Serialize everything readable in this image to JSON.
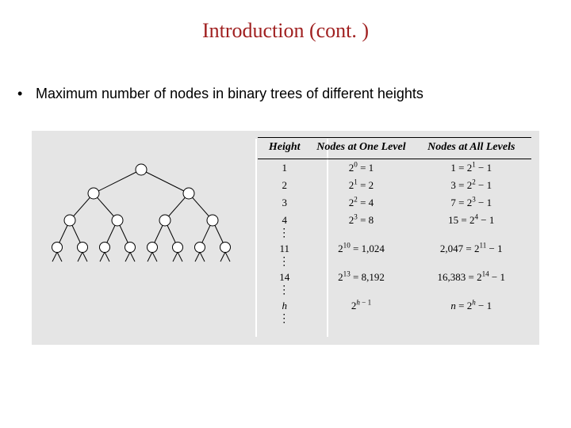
{
  "title": "Introduction (cont. )",
  "bullet": "Maximum number of nodes in binary trees of different heights",
  "table": {
    "headers": {
      "height": "Height",
      "one": "Nodes at One Level",
      "all": "Nodes at All Levels"
    },
    "rows": [
      {
        "height": "1",
        "one_base": "2",
        "one_exp": "0",
        "one_val": "1",
        "all_lhs": "1",
        "all_base": "2",
        "all_exp": "1",
        "all_tail": " − 1"
      },
      {
        "height": "2",
        "one_base": "2",
        "one_exp": "1",
        "one_val": "2",
        "all_lhs": "3",
        "all_base": "2",
        "all_exp": "2",
        "all_tail": " − 1"
      },
      {
        "height": "3",
        "one_base": "2",
        "one_exp": "2",
        "one_val": "4",
        "all_lhs": "7",
        "all_base": "2",
        "all_exp": "3",
        "all_tail": " − 1"
      },
      {
        "height": "4",
        "one_base": "2",
        "one_exp": "3",
        "one_val": "8",
        "all_lhs": "15",
        "all_base": "2",
        "all_exp": "4",
        "all_tail": " − 1"
      },
      {
        "height": "11",
        "one_base": "2",
        "one_exp": "10",
        "one_val": "1,024",
        "all_lhs": "2,047",
        "all_base": "2",
        "all_exp": "11",
        "all_tail": " − 1"
      },
      {
        "height": "14",
        "one_base": "2",
        "one_exp": "13",
        "one_val": "8,192",
        "all_lhs": "16,383",
        "all_base": "2",
        "all_exp": "14",
        "all_tail": " − 1"
      },
      {
        "height": "h",
        "one_base": "2",
        "one_exp": "h − 1",
        "one_val": "",
        "all_lhs": "n",
        "all_base": "2",
        "all_exp": "h",
        "all_tail": " − 1"
      }
    ],
    "vdots_after": [
      3,
      4,
      5,
      6
    ]
  },
  "chart_data": {
    "type": "table",
    "title": "Maximum number of nodes in binary trees of different heights",
    "columns": [
      "Height",
      "Nodes at One Level",
      "Nodes at All Levels"
    ],
    "rows": [
      [
        "1",
        "2^0 = 1",
        "1 = 2^1 − 1"
      ],
      [
        "2",
        "2^1 = 2",
        "3 = 2^2 − 1"
      ],
      [
        "3",
        "2^2 = 4",
        "7 = 2^3 − 1"
      ],
      [
        "4",
        "2^3 = 8",
        "15 = 2^4 − 1"
      ],
      [
        "11",
        "2^10 = 1,024",
        "2,047 = 2^11 − 1"
      ],
      [
        "14",
        "2^13 = 8,192",
        "16,383 = 2^14 − 1"
      ],
      [
        "h",
        "2^(h−1)",
        "n = 2^h − 1"
      ]
    ]
  }
}
